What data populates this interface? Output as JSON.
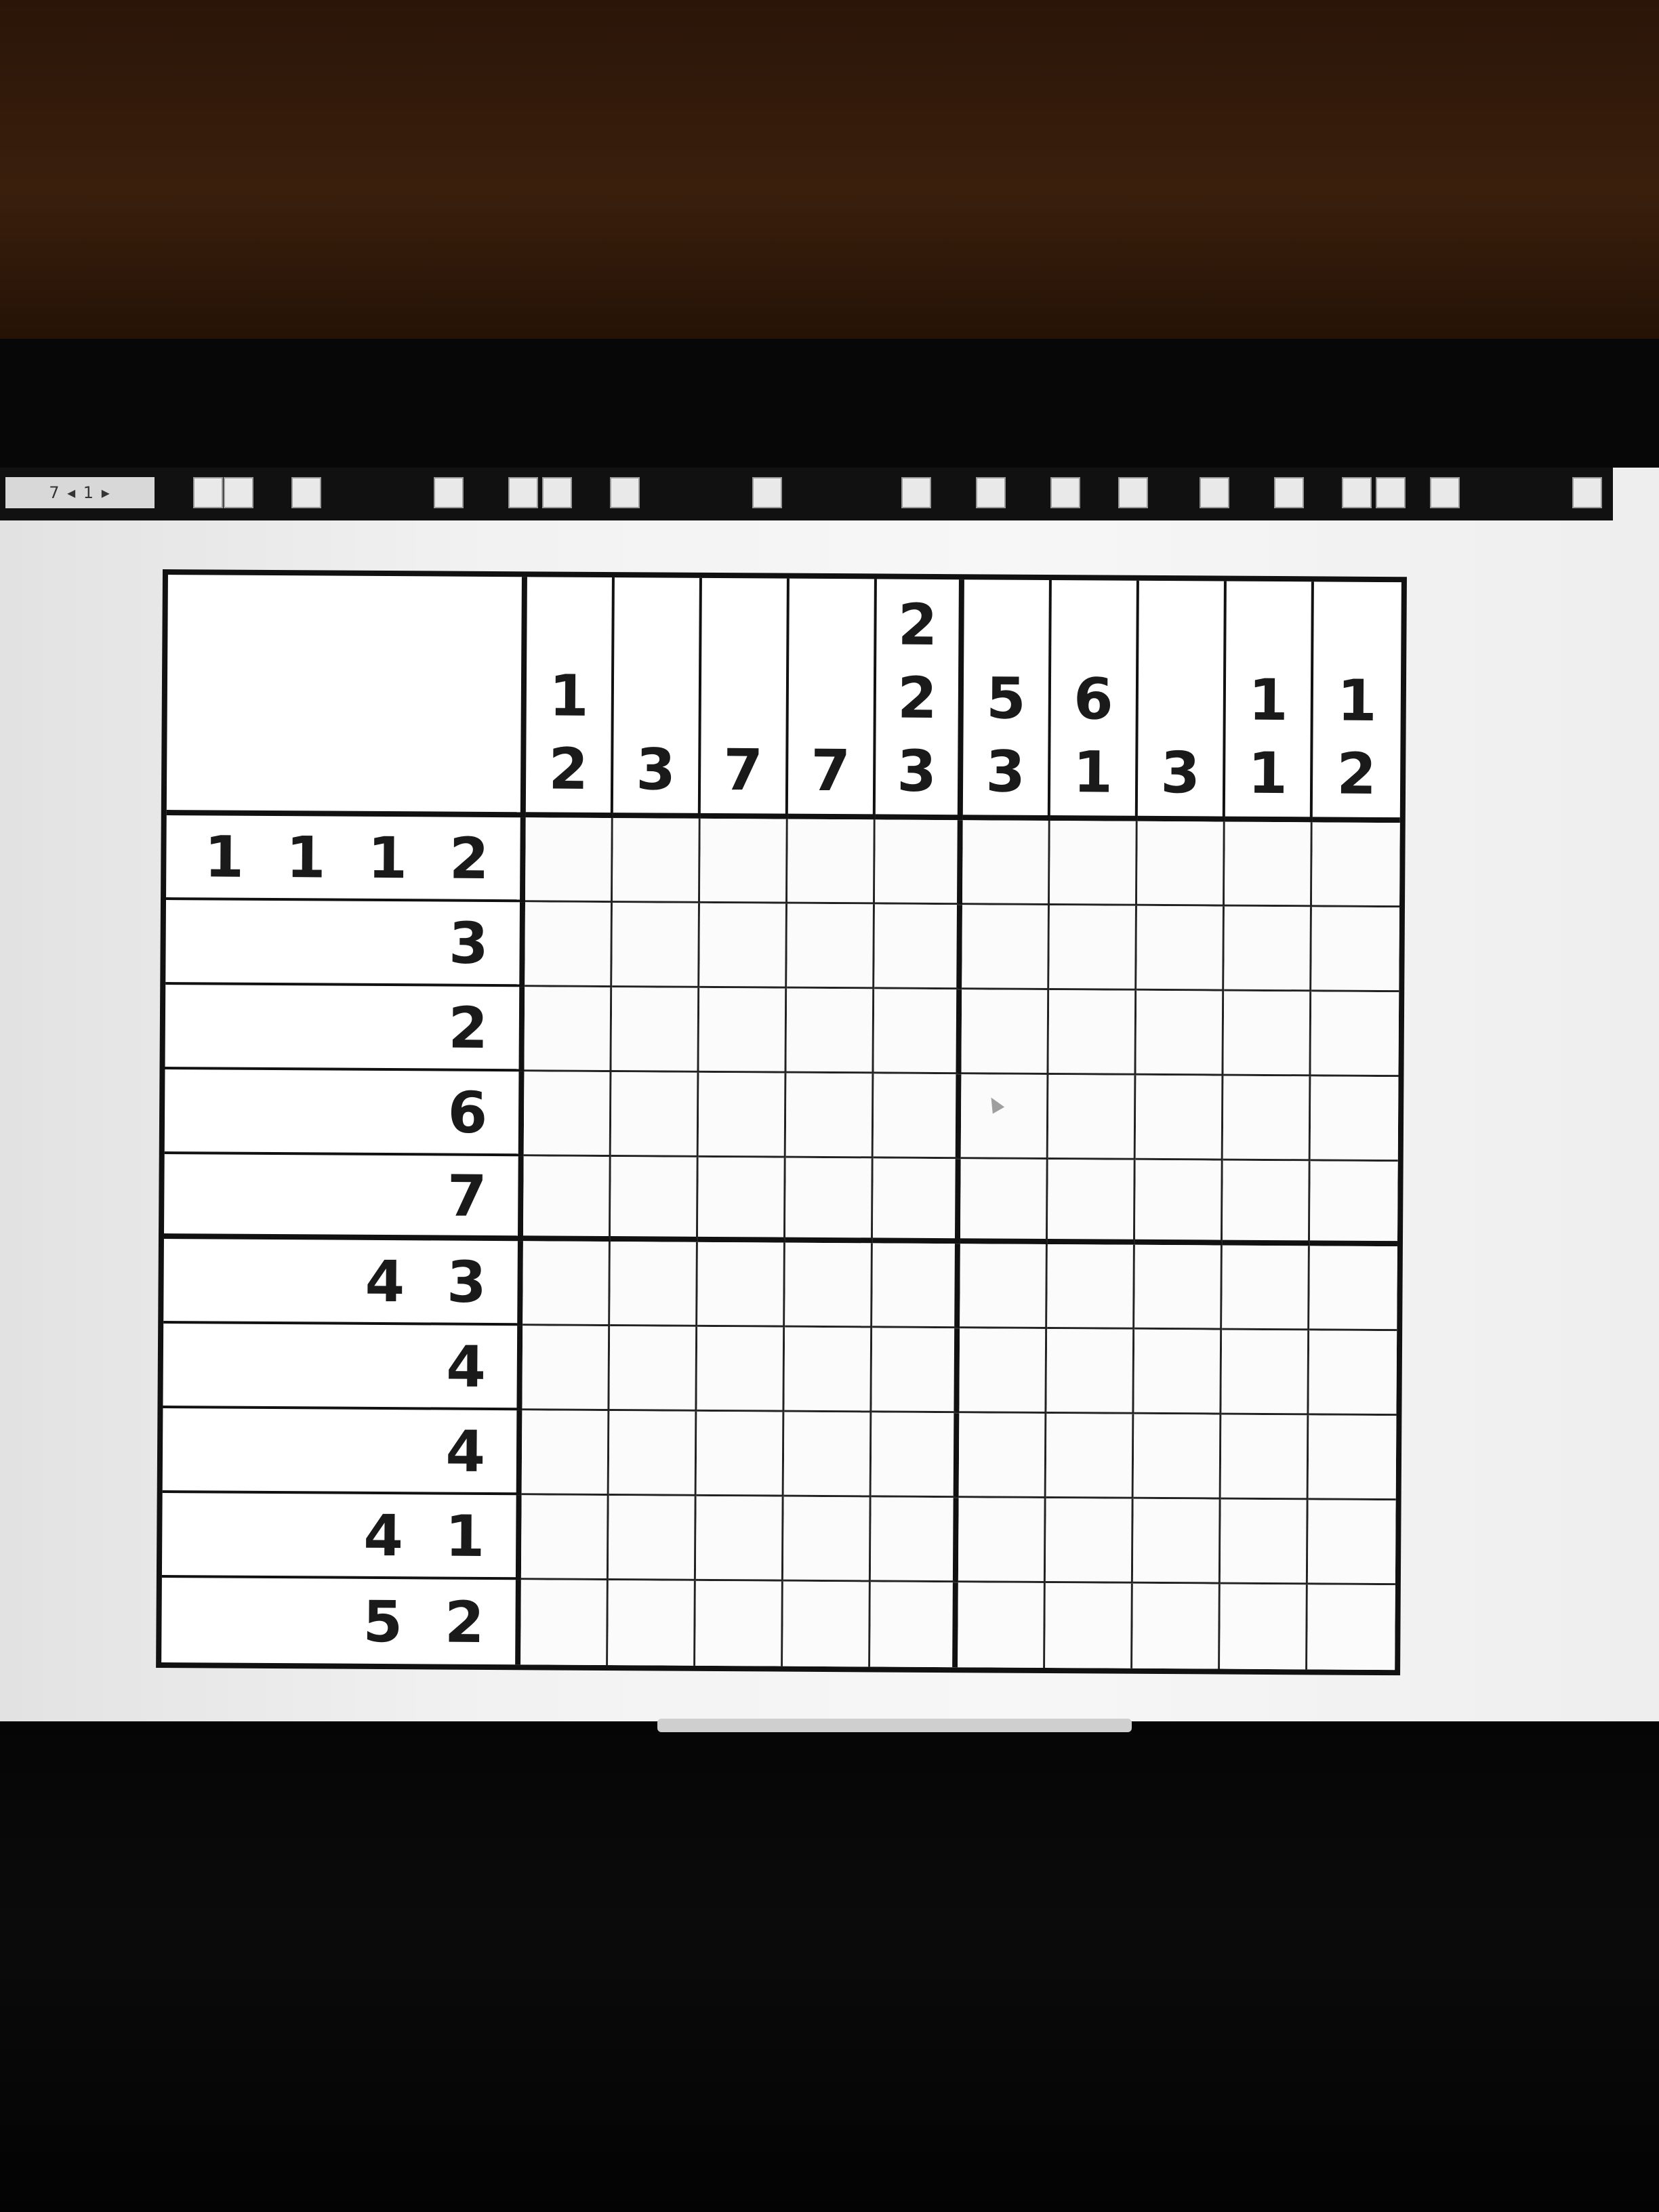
{
  "toolbar": {
    "label": "7 ◂ 1 ▸",
    "icons": [
      "tool-icon",
      "tool-icon",
      "tool-icon",
      "tool-icon",
      "tool-icon",
      "tool-icon",
      "tool-icon",
      "tool-icon",
      "tool-icon",
      "tool-icon",
      "tool-icon",
      "tool-icon",
      "tool-icon",
      "tool-icon",
      "tool-icon",
      "tool-icon",
      "tool-icon",
      "tool-icon"
    ]
  },
  "puzzle": {
    "type": "nonogram",
    "columns": 10,
    "rows": 10,
    "column_clues": [
      [
        "1",
        "2"
      ],
      [
        "3"
      ],
      [
        "7"
      ],
      [
        "7"
      ],
      [
        "2",
        "2",
        "3"
      ],
      [
        "5",
        "3"
      ],
      [
        "6",
        "1"
      ],
      [
        "3"
      ],
      [
        "1",
        "1"
      ],
      [
        "1",
        "2"
      ]
    ],
    "row_clues": [
      [
        "1",
        "1",
        "1",
        "2"
      ],
      [
        "3"
      ],
      [
        "2"
      ],
      [
        "6"
      ],
      [
        "7"
      ],
      [
        "4",
        "3"
      ],
      [
        "4"
      ],
      [
        "4"
      ],
      [
        "4",
        "1"
      ],
      [
        "5",
        "2"
      ]
    ]
  },
  "colors": {
    "grid_line": "#111111",
    "cell_background": "#fbfbfb",
    "screen_background": "#f2f2f2"
  }
}
